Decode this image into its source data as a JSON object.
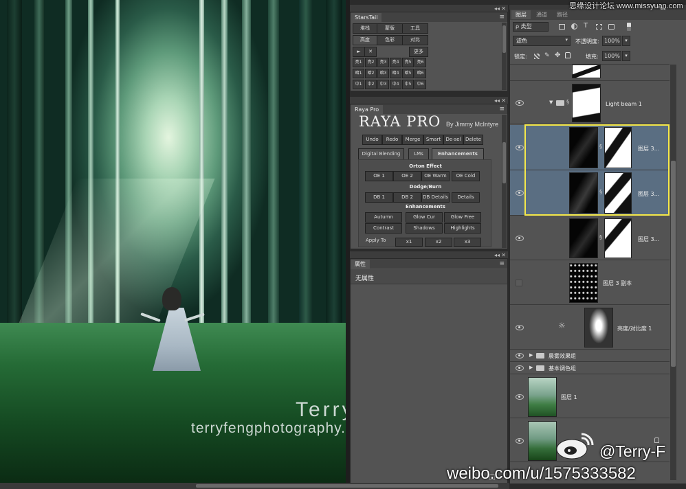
{
  "watermark": {
    "site": "思缘设计论坛 www.missyuan.com",
    "name": "Terry  F",
    "url": "terryfengphotography.lofter.com"
  },
  "starstail": {
    "title": "StarsTail",
    "row1": [
      "堆栈",
      "蒙版",
      "工具"
    ],
    "row2": [
      "高度",
      "色彩",
      "对比"
    ],
    "row3": [
      "►",
      "✕",
      "更多"
    ],
    "grid": [
      [
        "亮1",
        "亮2",
        "亮3",
        "亮4",
        "亮5",
        "亮6"
      ],
      [
        "暗1",
        "暗2",
        "暗3",
        "暗4",
        "暗5",
        "暗6"
      ],
      [
        "中1",
        "中2",
        "中3",
        "中4",
        "中5",
        "中6"
      ]
    ]
  },
  "raya": {
    "title": "Raya Pro",
    "logo": "RAYA PRO",
    "by": "By Jimmy McIntyre",
    "toolbar": [
      "Undo",
      "Redo",
      "Merge",
      "Smart",
      "De-sel",
      "Delete"
    ],
    "tabs": [
      "Digital Blending",
      "LMs",
      "Enhancements"
    ],
    "orton_title": "Orton Effect",
    "orton": [
      "OE 1",
      "OE 2",
      "OE Warm",
      "OE Cold"
    ],
    "dodge_title": "Dodge/Burn",
    "dodge": [
      "DB 1",
      "DB 2",
      "DB Details",
      "Details"
    ],
    "enh_title": "Enhancements",
    "enh1": [
      "Autumn",
      "Glow Cur",
      "Glow Free"
    ],
    "enh2": [
      "Contrast",
      "Shadows",
      "Highlights"
    ],
    "apply_label": "Apply To",
    "apply": [
      "x1",
      "x2",
      "x3"
    ]
  },
  "properties": {
    "title": "属性",
    "empty_text": "无属性"
  },
  "layers": {
    "tabs": [
      "图层",
      "通道",
      "路径"
    ],
    "filter_label": "ρ 类型",
    "blend_mode": "滤色",
    "opacity_label": "不透明度:",
    "opacity_value": "100%",
    "lock_label": "锁定:",
    "fill_label": "填充:",
    "fill_value": "100%",
    "items": [
      {
        "name": "Light beam 1"
      },
      {
        "name": "图层 3..."
      },
      {
        "name": "图层 3..."
      },
      {
        "name": "图层 3..."
      },
      {
        "name": "图层 3 副本"
      },
      {
        "name": "亮度/对比度 1"
      },
      {
        "name": "晨雾效果组"
      },
      {
        "name": "基本调色组"
      },
      {
        "name": "图层 1"
      }
    ]
  },
  "overlay": {
    "brand": "@Terry-F",
    "weibo": "weibo.com/u/1575333582"
  }
}
